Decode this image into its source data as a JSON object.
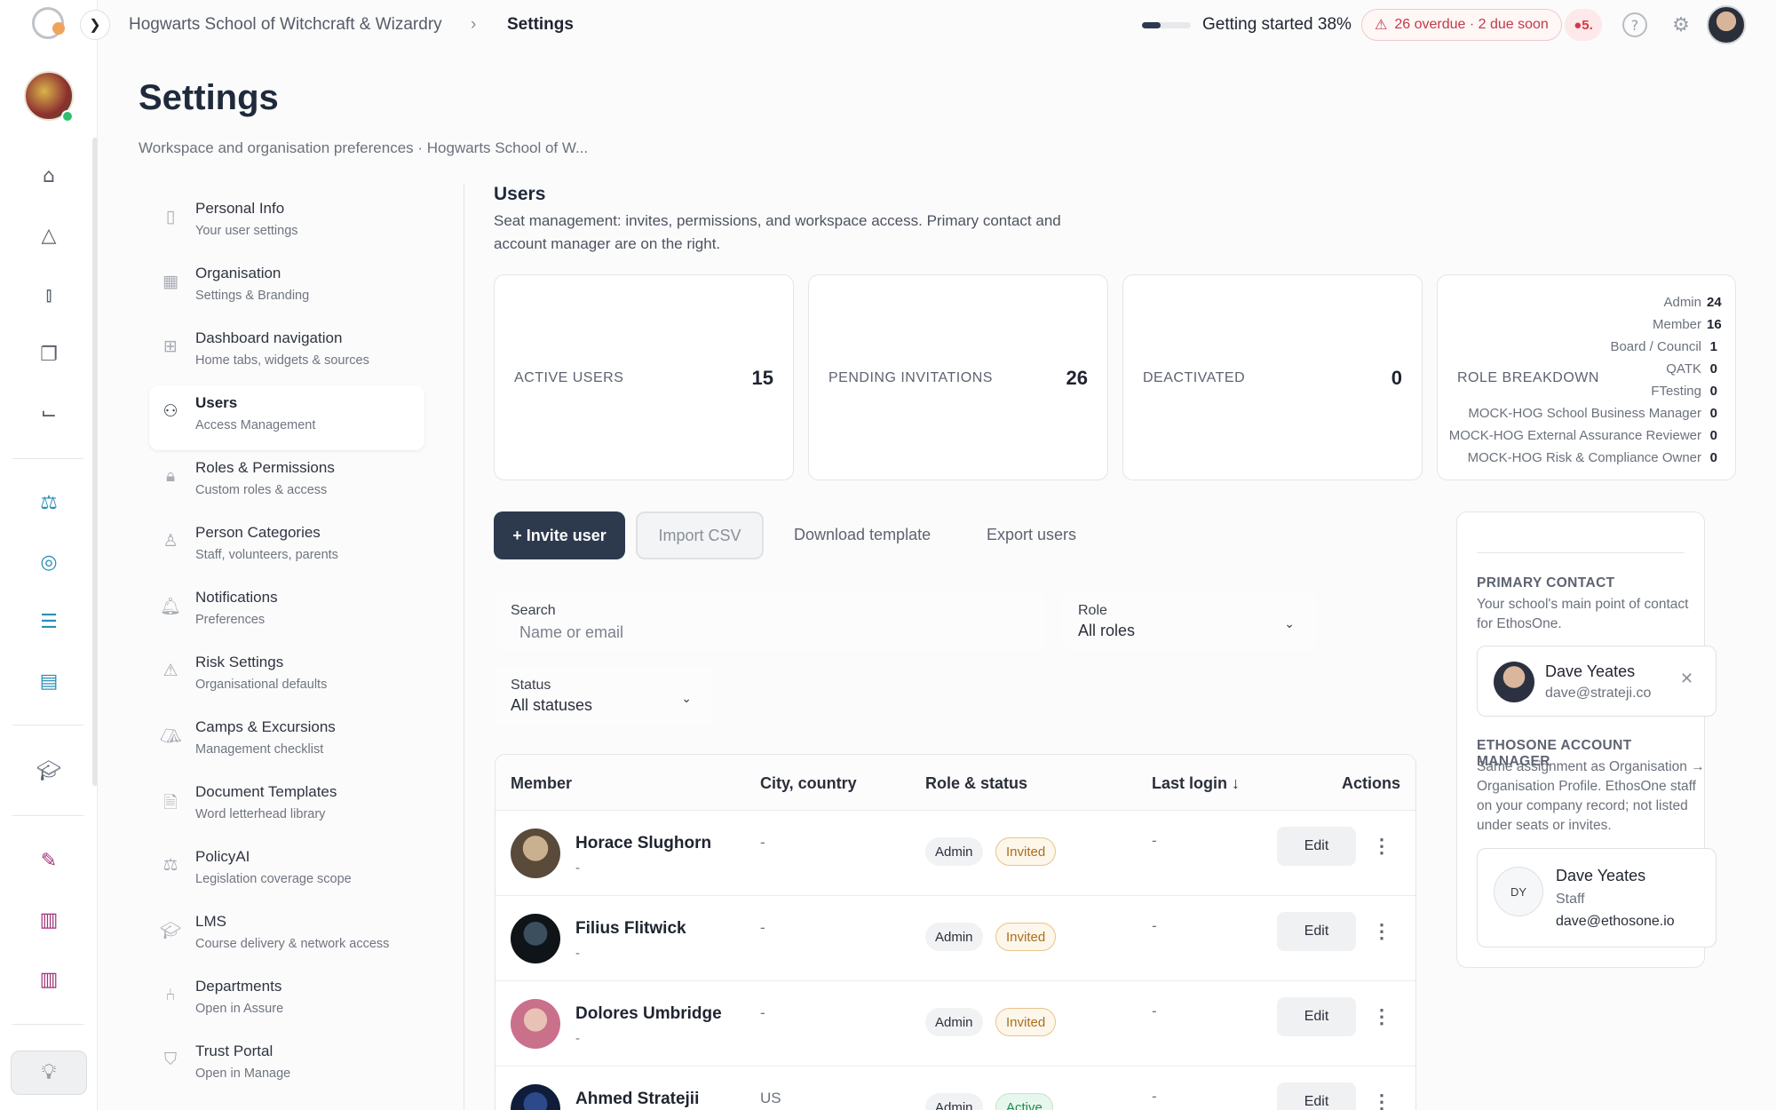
{
  "header": {
    "breadcrumb_org": "Hogwarts School of Witchcraft & Wizardry",
    "breadcrumb_sep": "›",
    "breadcrumb_page": "Settings",
    "progress_fraction": 0.38,
    "progress_text": "Getting started 38%",
    "alert_text": "26 overdue · 2 due soon",
    "notif_count": "5."
  },
  "page": {
    "title": "Settings",
    "subtitle": "Workspace and organisation preferences · Hogwarts School of W..."
  },
  "nav": [
    {
      "label": "Personal Info",
      "sub": "Your user settings",
      "icon": "user-card-icon",
      "glyph": "▯"
    },
    {
      "label": "Organisation",
      "sub": "Settings & Branding",
      "icon": "building-icon",
      "glyph": "▦"
    },
    {
      "label": "Dashboard navigation",
      "sub": "Home tabs, widgets & sources",
      "icon": "layout-icon",
      "glyph": "⊞"
    },
    {
      "label": "Users",
      "sub": "Access Management",
      "icon": "users-icon",
      "glyph": "⚇"
    },
    {
      "label": "Roles & Permissions",
      "sub": "Custom roles & access",
      "icon": "lock-icon",
      "glyph": "🔒︎"
    },
    {
      "label": "Person Categories",
      "sub": "Staff, volunteers, parents",
      "icon": "person-icon",
      "glyph": "♙"
    },
    {
      "label": "Notifications",
      "sub": "Preferences",
      "icon": "bell-icon",
      "glyph": "🔔︎"
    },
    {
      "label": "Risk Settings",
      "sub": "Organisational defaults",
      "icon": "warning-icon",
      "glyph": "⚠"
    },
    {
      "label": "Camps & Excursions",
      "sub": "Management checklist",
      "icon": "tent-icon",
      "glyph": "⛺︎"
    },
    {
      "label": "Document Templates",
      "sub": "Word letterhead library",
      "icon": "document-icon",
      "glyph": "🗎"
    },
    {
      "label": "PolicyAI",
      "sub": "Legislation coverage scope",
      "icon": "scales-icon",
      "glyph": "⚖"
    },
    {
      "label": "LMS",
      "sub": "Course delivery & network access",
      "icon": "graduation-icon",
      "glyph": "🎓︎"
    },
    {
      "label": "Departments",
      "sub": "Open in Assure",
      "icon": "network-icon",
      "glyph": "⑃"
    },
    {
      "label": "Trust Portal",
      "sub": "Open in Manage",
      "icon": "shield-icon",
      "glyph": "⛉"
    }
  ],
  "users": {
    "title": "Users",
    "description": "Seat management: invites, permissions, and workspace access. Primary contact and account manager are on the right.",
    "stats": [
      {
        "label": "ACTIVE USERS",
        "value": "15"
      },
      {
        "label": "PENDING INVITATIONS",
        "value": "26"
      },
      {
        "label": "DEACTIVATED",
        "value": "0"
      }
    ],
    "role_breakdown_label": "ROLE BREAKDOWN",
    "role_breakdown": [
      {
        "role": "Admin",
        "count": "24"
      },
      {
        "role": "Member",
        "count": "16"
      },
      {
        "role": "Board / Council",
        "count": "1"
      },
      {
        "role": "QATK",
        "count": "0"
      },
      {
        "role": "FTesting",
        "count": "0"
      },
      {
        "role": "MOCK-HOG School Business Manager",
        "count": "0"
      },
      {
        "role": "MOCK-HOG External Assurance Reviewer",
        "count": "0"
      },
      {
        "role": "MOCK-HOG Risk & Compliance Owner",
        "count": "0"
      }
    ],
    "invite_label": "+ Invite user",
    "import_label": "Import CSV",
    "download_label": "Download template",
    "export_label": "Export users",
    "search_label": "Search",
    "search_placeholder": "Name or email",
    "role_filter_label": "Role",
    "role_filter_value": "All roles",
    "status_filter_label": "Status",
    "status_filter_value": "All statuses",
    "table": {
      "headers": [
        "Member",
        "City, country",
        "Role & status",
        "Last login ↓",
        "Actions"
      ],
      "edit_label": "Edit",
      "more_glyph": "⋮",
      "rows": [
        {
          "name": "Horace Slughorn",
          "sub": "-",
          "city": "-",
          "role": "Admin",
          "status": "Invited",
          "last_login": "-"
        },
        {
          "name": "Filius Flitwick",
          "sub": "-",
          "city": "-",
          "role": "Admin",
          "status": "Invited",
          "last_login": "-"
        },
        {
          "name": "Dolores Umbridge",
          "sub": "-",
          "city": "-",
          "role": "Admin",
          "status": "Invited",
          "last_login": "-"
        },
        {
          "name": "Ahmed Stratejii",
          "sub": "",
          "city": "US",
          "role": "Admin",
          "status": "Active",
          "last_login": "-"
        }
      ]
    }
  },
  "contact": {
    "primary_heading": "PRIMARY CONTACT",
    "primary_desc": "Your school's main point of contact for EthosOne.",
    "primary_name": "Dave Yeates",
    "primary_email": "dave@strateji.co",
    "manager_heading": "ETHOSONE ACCOUNT MANAGER",
    "manager_desc": "Same assignment as Organisation → Organisation Profile. EthosOne staff on your company record; not listed under seats or invites.",
    "manager_initials": "DY",
    "manager_name": "Dave Yeates",
    "manager_role": "Staff",
    "manager_email": "dave@ethosone.io"
  },
  "colors": {
    "primary": "#2d3a4d",
    "alert": "#c23a47",
    "invited": "#a8701e",
    "active": "#1f8a4c"
  }
}
